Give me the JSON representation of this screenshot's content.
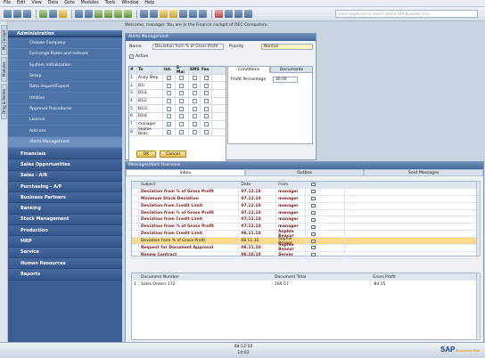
{
  "menu": [
    "File",
    "Edit",
    "View",
    "Data",
    "Goto",
    "Modules",
    "Tools",
    "Window",
    "Help"
  ],
  "search": {
    "placeholder": "Enter keywords to search within SAP Business One"
  },
  "left_tabs": [
    "My Cockpit",
    "Modules",
    "Drag & Relate"
  ],
  "nav": {
    "admin": "Administration",
    "admin_items": [
      "Choose Company",
      "Exchange Rates and Indexes",
      "System Initialization",
      "Setup",
      "Data Import/Export",
      "Utilities",
      "Approval Procedures",
      "Licence",
      "Add-ons",
      "Alerts Management"
    ],
    "modules": [
      "Financials",
      "Sales Opportunities",
      "Sales - A/R",
      "Purchasing - A/P",
      "Business Partners",
      "Banking",
      "Stock Management",
      "Production",
      "MRP",
      "Service",
      "Human Resources",
      "Reports"
    ]
  },
  "welcome": "Welcome, manager. You are in the Finance cockpit of OEC Computers.",
  "alert": {
    "title": "Alerts Management",
    "name_label": "Name",
    "name_value": "Deviation from % of Gross Profit",
    "priority_label": "Priority",
    "priority_value": "Normal",
    "active_label": "Active",
    "grid_head": [
      "#",
      "To",
      "Int.",
      "E-Mai",
      "SMS",
      "Fax"
    ],
    "grid_rows": [
      {
        "n": "1",
        "to": "Andy Step",
        "int": "✓"
      },
      {
        "n": "2",
        "to": "B1i",
        "int": ""
      },
      {
        "n": "3",
        "to": "B1i1",
        "int": ""
      },
      {
        "n": "4",
        "to": "B1i2",
        "int": ""
      },
      {
        "n": "5",
        "to": "B1i3",
        "int": ""
      },
      {
        "n": "6",
        "to": "B1i4",
        "int": ""
      },
      {
        "n": "7",
        "to": "manager",
        "int": "✓"
      },
      {
        "n": "8",
        "to": "Sophie Beac",
        "int": "✓"
      }
    ],
    "tab_conditions": "Conditions",
    "tab_documents": "Documents",
    "profit_label": "Profit Percentage",
    "profit_value": "30.00",
    "ok": "OK",
    "cancel": "Cancel"
  },
  "messages": {
    "title": "Messages/Alert Overview",
    "tabs": [
      "Inbox",
      "Outbox",
      "Sent Messages"
    ],
    "head": [
      "Subject",
      "Date",
      "From"
    ],
    "rows": [
      {
        "subject": "Deviation from % of Gross Profit",
        "date": "07.12.10",
        "from": "manager",
        "bold": true
      },
      {
        "subject": "Minimum Stock Deviation",
        "date": "07.12.10",
        "from": "manager",
        "bold": true
      },
      {
        "subject": "Deviation from Credit Limit",
        "date": "07.12.10",
        "from": "manager",
        "bold": true
      },
      {
        "subject": "Deviation from % of Gross Profit",
        "date": "07.12.10",
        "from": "manager",
        "bold": true
      },
      {
        "subject": "Deviation from Credit Limit",
        "date": "07.12.10",
        "from": "manager",
        "bold": true
      },
      {
        "subject": "Deviation from % of Gross Profit",
        "date": "07.12.10",
        "from": "manager",
        "bold": true
      },
      {
        "subject": "Deviation from Credit Limit",
        "date": "08.11.10",
        "from": "Sophie Beacor",
        "bold": true
      },
      {
        "subject": "Deviation from % of Gross Profit",
        "date": "08.11.10",
        "from": "Sophie Beacor",
        "bold": false,
        "sel": true
      },
      {
        "subject": "Request for Document Approval",
        "date": "08.11.10",
        "from": "Sophie Beacor",
        "bold": true
      },
      {
        "subject": "Renew Contract",
        "date": "08.10.10",
        "from": "Server",
        "bold": true
      }
    ],
    "detail_head": [
      "Document Number",
      "Document Total",
      "Gross Profit"
    ],
    "detail_row": {
      "doc": "Sales Orders 172",
      "total": "169.57",
      "profit": "-84.15"
    }
  },
  "status": {
    "time": "08:12:10",
    "time2": "14:02"
  },
  "brand": {
    "logo": "SAP",
    "sub": "Business One"
  }
}
